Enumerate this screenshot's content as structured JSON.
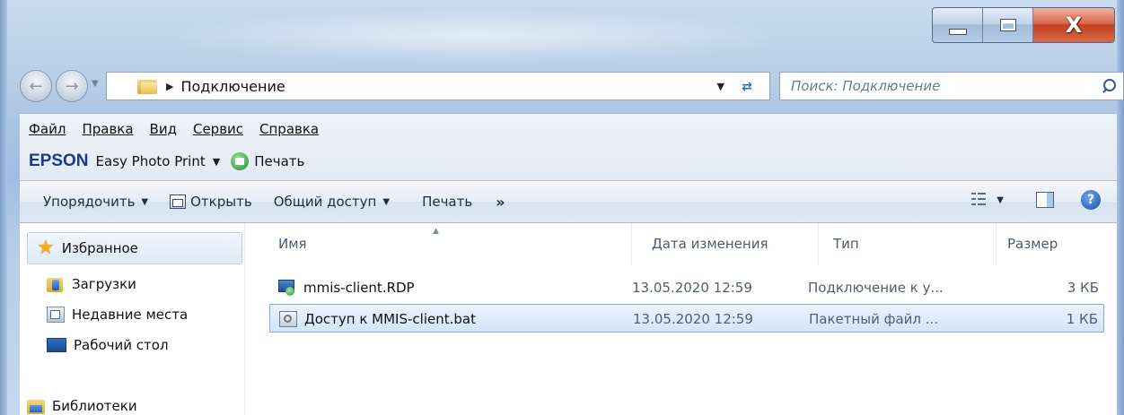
{
  "window": {
    "minimize_label": "",
    "maximize_label": "",
    "close_label": "X"
  },
  "address": {
    "path": "Подключение"
  },
  "search": {
    "placeholder": "Поиск: Подключение"
  },
  "menu": {
    "items": [
      {
        "label": "Файл"
      },
      {
        "label": "Правка"
      },
      {
        "label": "Вид"
      },
      {
        "label": "Сервис"
      },
      {
        "label": "Справка"
      }
    ]
  },
  "epson": {
    "logo": "EPSON",
    "product": "Easy Photo Print",
    "print_label": "Печать"
  },
  "command_bar": {
    "organize_label": "Упорядочить",
    "open_label": "Открыть",
    "share_label": "Общий доступ",
    "print_label": "Печать",
    "more_label": "»",
    "help_label": "?"
  },
  "nav_pane": {
    "favorites_label": "Избранное",
    "downloads_label": "Загрузки",
    "recent_label": "Недавние места",
    "desktop_label": "Рабочий стол",
    "libraries_label": "Библиотеки"
  },
  "columns": {
    "name": "Имя",
    "date": "Дата изменения",
    "type": "Тип",
    "size": "Размер"
  },
  "files": [
    {
      "name": "mmis-client.RDP",
      "date": "13.05.2020 12:59",
      "type": "Подключение к у...",
      "size": "3 КБ",
      "icon": "rdp-file-icon"
    },
    {
      "name": "Доступ к MMIS-client.bat",
      "date": "13.05.2020 12:59",
      "type": "Пакетный файл ...",
      "size": "1 КБ",
      "icon": "batch-file-icon",
      "selected": true
    }
  ],
  "colors": {
    "frame": "#a9c4e3",
    "selection": "#d3e5f9",
    "selection_border": "#7eaee5",
    "close_button": "#c2401f",
    "epson_blue": "#1a3a8a"
  }
}
